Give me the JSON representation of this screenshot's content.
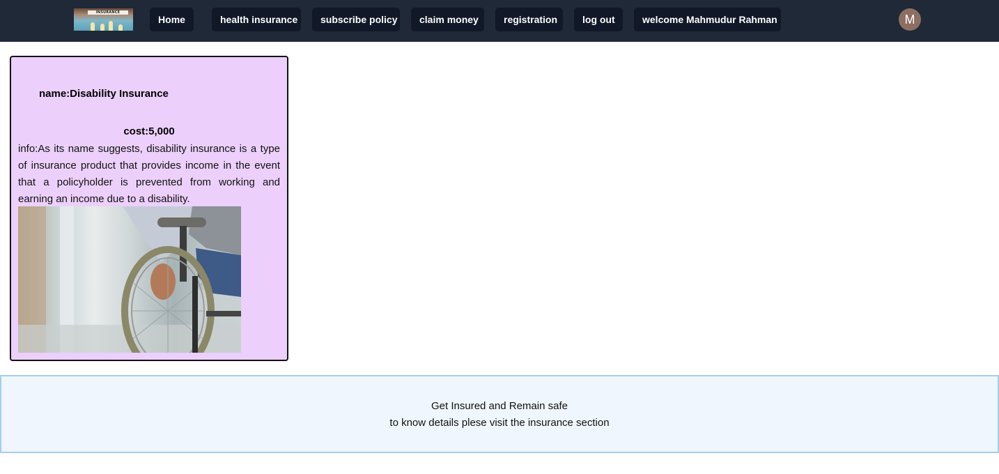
{
  "navbar": {
    "logo_text": "INSURANCE",
    "items": [
      {
        "label": "Home"
      },
      {
        "label": "health insurance"
      },
      {
        "label": "subscribe policy"
      },
      {
        "label": "claim money"
      },
      {
        "label": "registration"
      },
      {
        "label": "log out"
      },
      {
        "label": "welcome Mahmudur Rahman"
      }
    ],
    "avatar_initial": "M"
  },
  "card": {
    "name": "name:Disability Insurance",
    "cost": "cost:5,000",
    "info": "info:As its name suggests, disability insurance is a type of insurance product that provides income in the event that a policyholder is prevented from working and earning an income due to a disability."
  },
  "footer": {
    "line1": "Get Insured and Remain safe",
    "line2": "to know details plese visit the insurance section"
  },
  "colors": {
    "navbar_bg": "#1f2937",
    "nav_button_bg": "#111827",
    "card_bg": "#ecd0fb",
    "footer_bg": "#eff6fd",
    "footer_border": "#a5cdee",
    "avatar_bg": "#8d6e63"
  }
}
